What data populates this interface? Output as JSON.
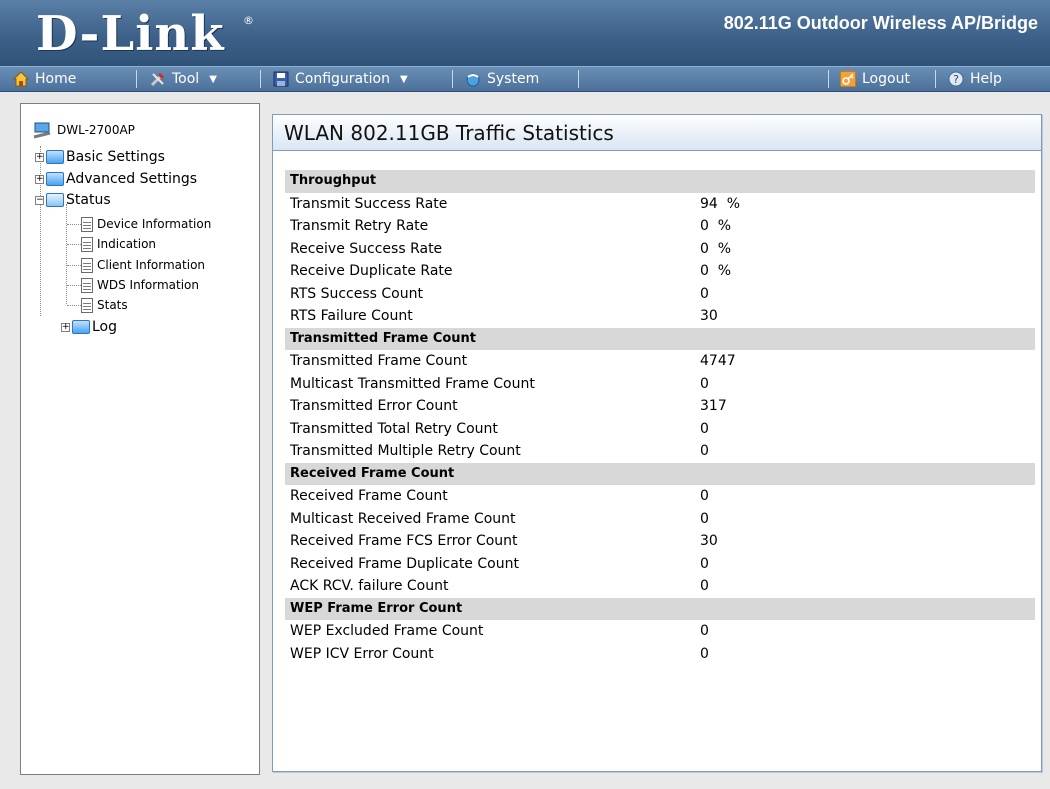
{
  "header": {
    "logo": "D-Link",
    "logo_mark": "®",
    "product_title": "802.11G Outdoor Wireless AP/Bridge"
  },
  "menu": {
    "home": "Home",
    "tool": "Tool",
    "configuration": "Configuration",
    "system": "System",
    "logout": "Logout",
    "help": "Help"
  },
  "tree": {
    "root": "DWL-2700AP",
    "basic_settings": "Basic Settings",
    "advanced_settings": "Advanced Settings",
    "status": "Status",
    "status_children": [
      "Device Information",
      "Indication",
      "Client Information",
      "WDS Information",
      "Stats"
    ],
    "log": "Log"
  },
  "main": {
    "title": "WLAN 802.11GB Traffic Statistics",
    "sections": [
      {
        "heading": "Throughput",
        "rows": [
          {
            "label": "Transmit Success Rate",
            "value": "94  %"
          },
          {
            "label": "Transmit Retry Rate",
            "value": "0  %"
          },
          {
            "label": "Receive Success Rate",
            "value": "0  %"
          },
          {
            "label": "Receive Duplicate Rate",
            "value": "0  %"
          },
          {
            "label": "RTS Success Count",
            "value": "0"
          },
          {
            "label": "RTS Failure Count",
            "value": "30"
          }
        ]
      },
      {
        "heading": "Transmitted Frame Count",
        "rows": [
          {
            "label": "Transmitted Frame Count",
            "value": "4747"
          },
          {
            "label": "Multicast Transmitted Frame Count",
            "value": "0"
          },
          {
            "label": "Transmitted Error Count",
            "value": "317"
          },
          {
            "label": "Transmitted Total Retry Count",
            "value": "0"
          },
          {
            "label": "Transmitted Multiple Retry Count",
            "value": "0"
          }
        ]
      },
      {
        "heading": "Received Frame Count",
        "rows": [
          {
            "label": "Received Frame Count",
            "value": "0"
          },
          {
            "label": "Multicast Received Frame Count",
            "value": "0"
          },
          {
            "label": "Received Frame FCS Error Count",
            "value": "30"
          },
          {
            "label": "Received Frame Duplicate Count",
            "value": "0"
          },
          {
            "label": "ACK RCV. failure Count",
            "value": "0"
          }
        ]
      },
      {
        "heading": "WEP Frame Error Count",
        "rows": [
          {
            "label": "WEP Excluded Frame Count",
            "value": "0"
          },
          {
            "label": "WEP ICV Error Count",
            "value": "0"
          }
        ]
      }
    ]
  }
}
